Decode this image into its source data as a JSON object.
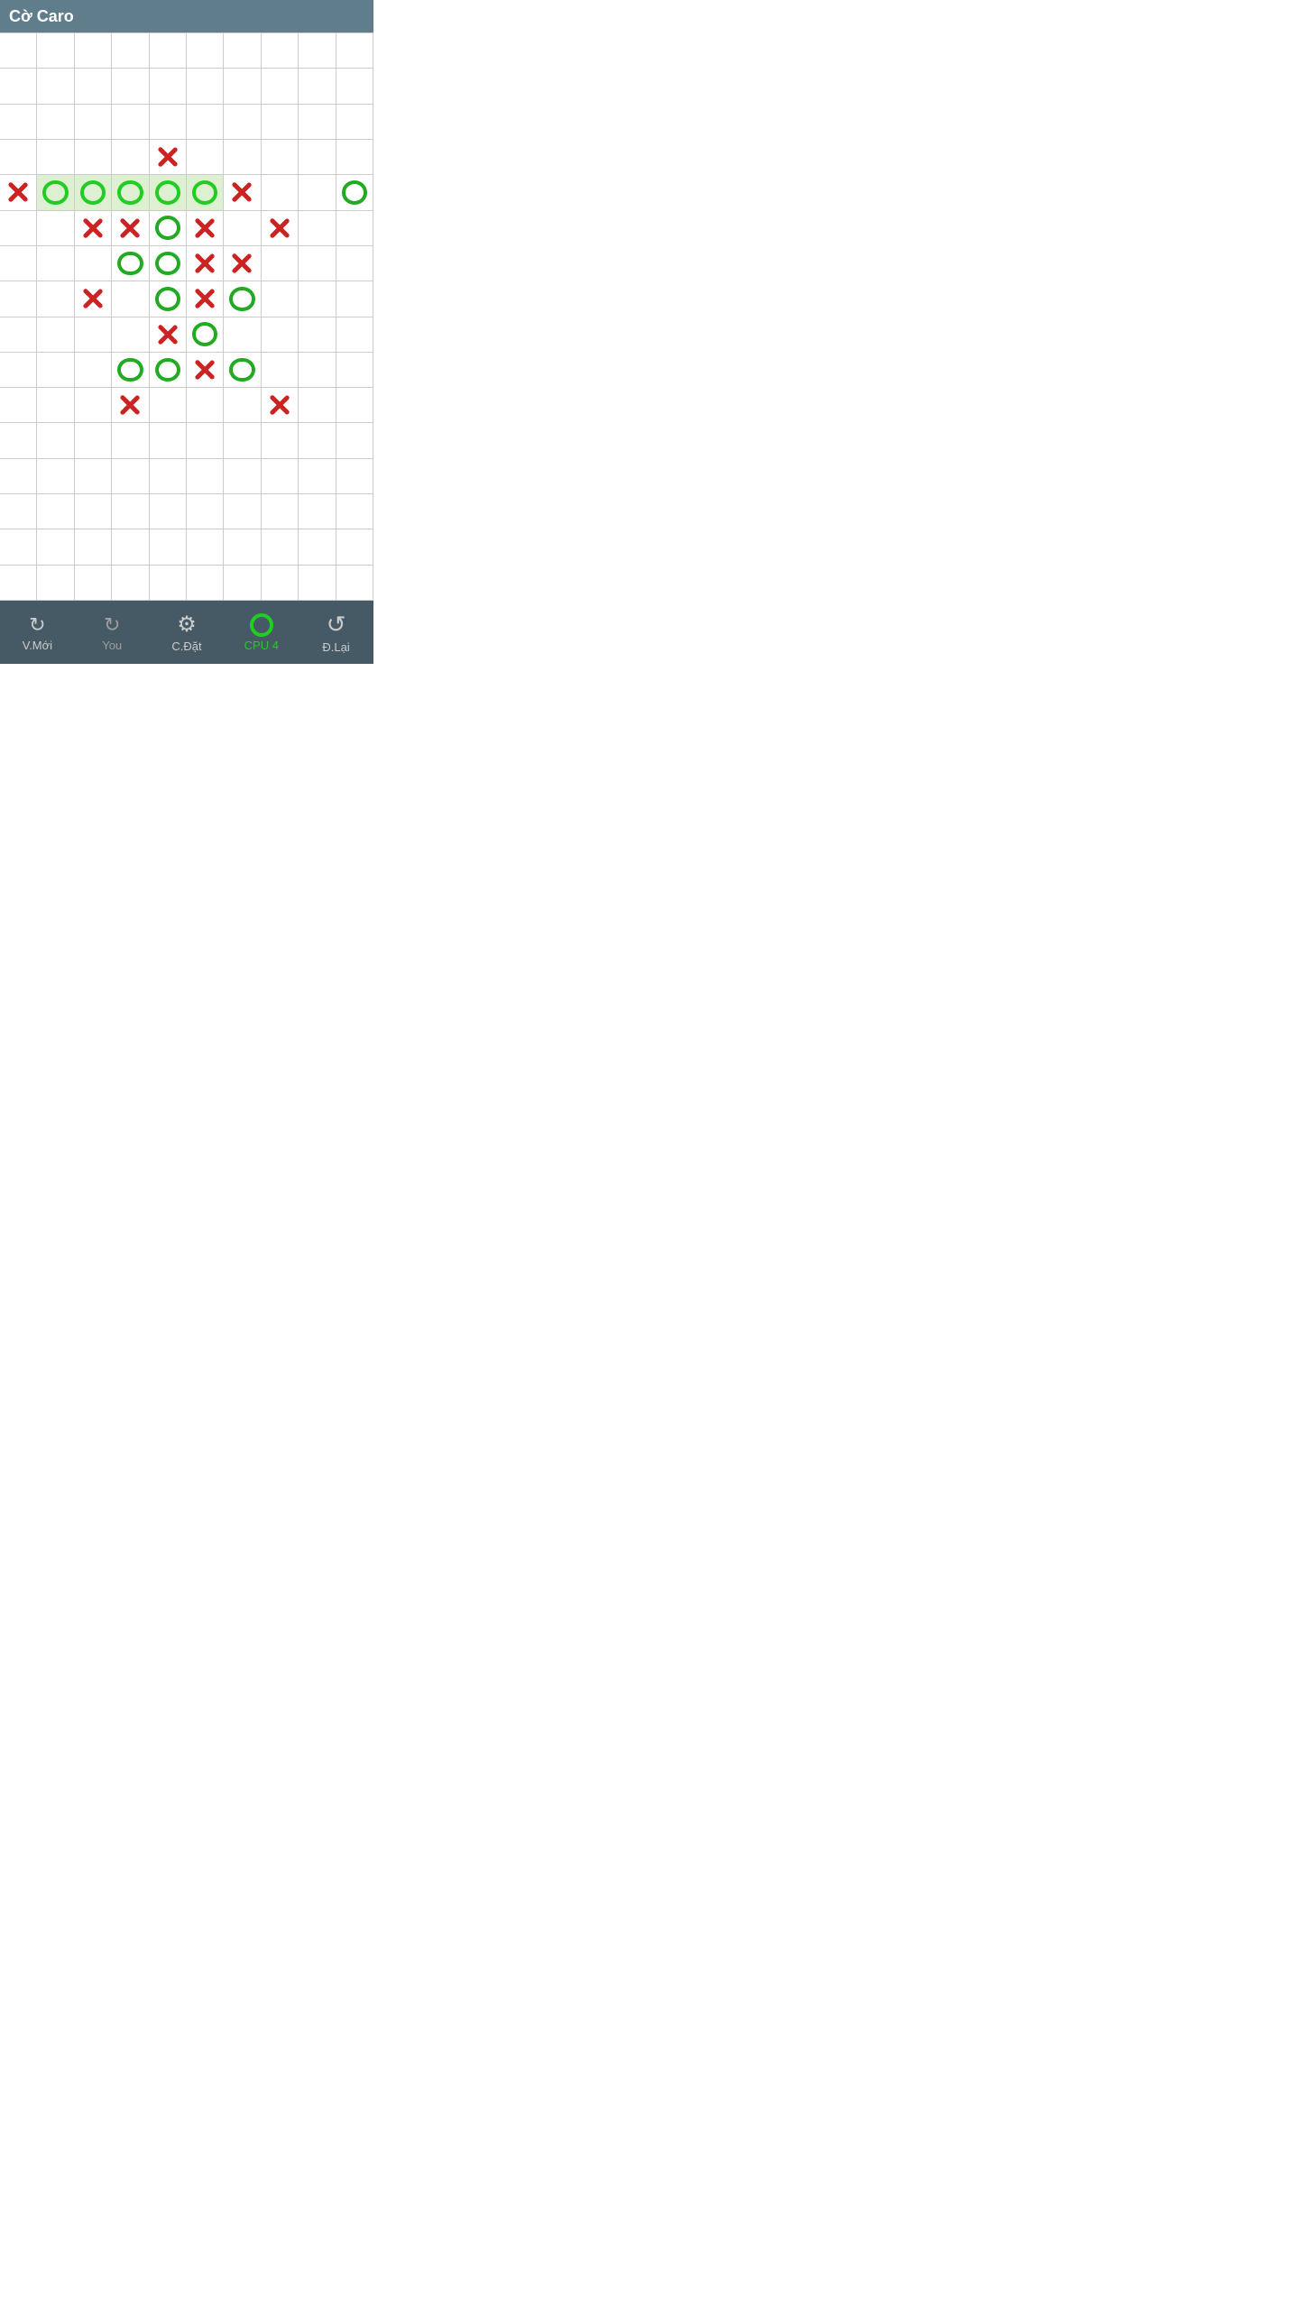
{
  "header": {
    "title": "Cờ Caro"
  },
  "board": {
    "cols": 10,
    "rows": 16,
    "pieces": [
      {
        "row": 3,
        "col": 4,
        "type": "X"
      },
      {
        "row": 4,
        "col": 0,
        "type": "X"
      },
      {
        "row": 4,
        "col": 1,
        "type": "O",
        "highlight": true
      },
      {
        "row": 4,
        "col": 2,
        "type": "O",
        "highlight": true
      },
      {
        "row": 4,
        "col": 3,
        "type": "O",
        "highlight": true
      },
      {
        "row": 4,
        "col": 4,
        "type": "O",
        "highlight": true
      },
      {
        "row": 4,
        "col": 5,
        "type": "O",
        "highlight": true
      },
      {
        "row": 4,
        "col": 6,
        "type": "X"
      },
      {
        "row": 4,
        "col": 9,
        "type": "O"
      },
      {
        "row": 5,
        "col": 2,
        "type": "X"
      },
      {
        "row": 5,
        "col": 3,
        "type": "X"
      },
      {
        "row": 5,
        "col": 4,
        "type": "O"
      },
      {
        "row": 5,
        "col": 5,
        "type": "X"
      },
      {
        "row": 5,
        "col": 7,
        "type": "X"
      },
      {
        "row": 6,
        "col": 3,
        "type": "O"
      },
      {
        "row": 6,
        "col": 4,
        "type": "O"
      },
      {
        "row": 6,
        "col": 5,
        "type": "X"
      },
      {
        "row": 6,
        "col": 6,
        "type": "X"
      },
      {
        "row": 7,
        "col": 2,
        "type": "X"
      },
      {
        "row": 7,
        "col": 4,
        "type": "O"
      },
      {
        "row": 7,
        "col": 5,
        "type": "X"
      },
      {
        "row": 7,
        "col": 6,
        "type": "O"
      },
      {
        "row": 8,
        "col": 4,
        "type": "X"
      },
      {
        "row": 8,
        "col": 5,
        "type": "O"
      },
      {
        "row": 9,
        "col": 3,
        "type": "O"
      },
      {
        "row": 9,
        "col": 4,
        "type": "O"
      },
      {
        "row": 9,
        "col": 5,
        "type": "X"
      },
      {
        "row": 9,
        "col": 6,
        "type": "O"
      },
      {
        "row": 10,
        "col": 3,
        "type": "X"
      },
      {
        "row": 10,
        "col": 7,
        "type": "X"
      }
    ],
    "highlight_row": 4,
    "highlight_cols": [
      1,
      2,
      3,
      4,
      5
    ]
  },
  "footer": {
    "btn_new": "V.Mới",
    "btn_you": "You",
    "btn_settings": "C.Đặt",
    "btn_cpu": "CPU 4",
    "btn_undo": "Đ.Lại"
  }
}
